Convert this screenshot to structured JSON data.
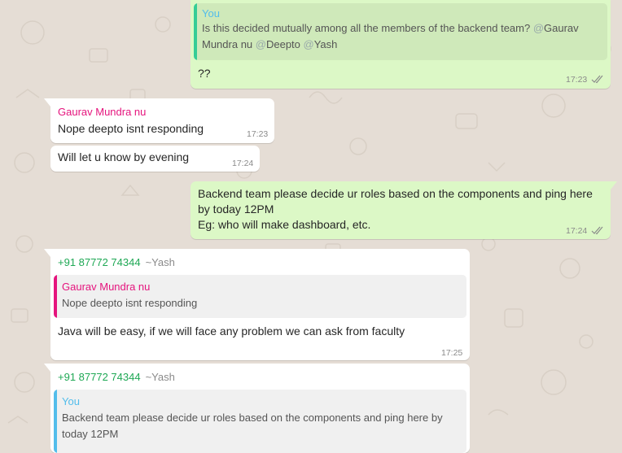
{
  "messages": {
    "m1": {
      "quote_author": "You",
      "quote_text_1": "Is this decided mutually among all the members of the backend team? ",
      "quote_mention_1": "@",
      "quote_name_1": "Gaurav",
      "quote_name_1b": "Mundra nu ",
      "quote_mention_2": "@",
      "quote_name_2": "Deepto ",
      "quote_mention_3": "@",
      "quote_name_3": "Yash",
      "text": "??",
      "time": "17:23"
    },
    "m2": {
      "sender": "Gaurav Mundra nu",
      "text": "Nope deepto isnt responding",
      "time": "17:23"
    },
    "m3": {
      "text": "Will let u know by evening",
      "time": "17:24"
    },
    "m4": {
      "line1": "Backend team please decide ur roles based on the components and ping here",
      "line2": "by today 12PM",
      "line3": "Eg: who will make dashboard, etc.",
      "time": "17:24"
    },
    "m5": {
      "phone": "+91 87772 74344",
      "alias": "~Yash",
      "quote_author": "Gaurav Mundra nu",
      "quote_text": "Nope deepto isnt responding",
      "text": "Java will be easy, if we will face any problem we can ask from faculty",
      "time": "17:25"
    },
    "m6": {
      "phone": "+91 87772 74344",
      "alias": "~Yash",
      "quote_author": "You",
      "quote_line1": "Backend team please decide ur roles based on the components and ping here by",
      "quote_line2": "today 12PM"
    }
  },
  "colors": {
    "outgoing_bubble": "#dcf8c6",
    "incoming_bubble": "#ffffff",
    "phone_green": "#1fa855",
    "sender_pink": "#e5147d",
    "you_blue": "#53bdeb",
    "read_ticks": "#8a8a8a"
  }
}
